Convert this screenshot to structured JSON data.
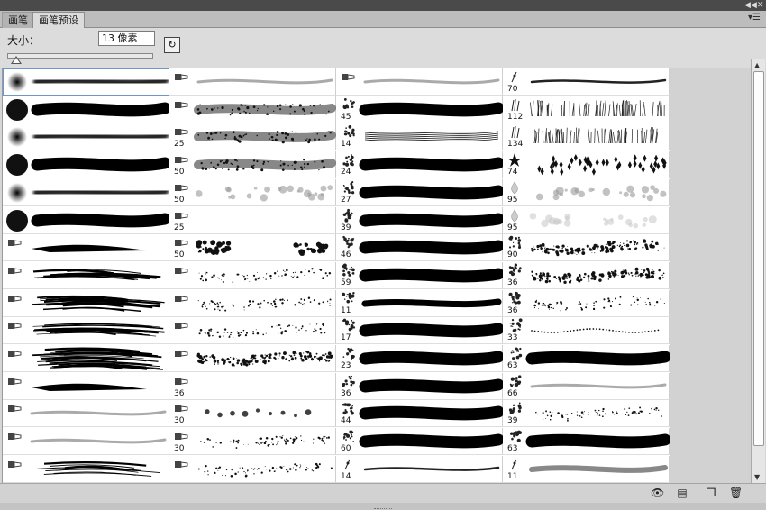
{
  "panel": {
    "tabs": [
      {
        "label": "画笔"
      },
      {
        "label": "画笔预设"
      }
    ],
    "collapse_icon": "double-chevron-icon",
    "menu_icon": "panel-menu-icon"
  },
  "size": {
    "label": "大小：",
    "value": "13 像素",
    "slider_fraction": 0.01
  },
  "brushes": [
    [
      {
        "num": "",
        "tip": "soft-round",
        "stroke": "soft"
      },
      {
        "num": "",
        "tip": "hard-round",
        "stroke": "hard"
      },
      {
        "num": "",
        "tip": "soft-round",
        "stroke": "soft"
      },
      {
        "num": "",
        "tip": "hard-round",
        "stroke": "hard"
      },
      {
        "num": "",
        "tip": "soft-round",
        "stroke": "soft"
      },
      {
        "num": "",
        "tip": "hard-round",
        "stroke": "hard"
      },
      {
        "num": "",
        "tip": "bristle",
        "stroke": "taper"
      },
      {
        "num": "",
        "tip": "bristle",
        "stroke": "streaks"
      },
      {
        "num": "",
        "tip": "bristle",
        "stroke": "dense-streaks"
      },
      {
        "num": "",
        "tip": "bristle",
        "stroke": "dense-streaks"
      },
      {
        "num": "",
        "tip": "bristle",
        "stroke": "wide-streaks"
      },
      {
        "num": "",
        "tip": "bristle",
        "stroke": "taper"
      },
      {
        "num": "",
        "tip": "bristle",
        "stroke": "faint"
      },
      {
        "num": "",
        "tip": "bristle",
        "stroke": "faint"
      },
      {
        "num": "",
        "tip": "bristle",
        "stroke": "streaks"
      }
    ],
    [
      {
        "num": "",
        "tip": "bristle",
        "stroke": "faint"
      },
      {
        "num": "",
        "tip": "bristle",
        "stroke": "textured"
      },
      {
        "num": "25",
        "tip": "bristle",
        "stroke": "textured"
      },
      {
        "num": "50",
        "tip": "bristle",
        "stroke": "textured"
      },
      {
        "num": "50",
        "tip": "bristle",
        "stroke": "speckle"
      },
      {
        "num": "25",
        "tip": "bristle",
        "stroke": "none"
      },
      {
        "num": "50",
        "tip": "bristle",
        "stroke": "blobs"
      },
      {
        "num": "",
        "tip": "bristle",
        "stroke": "spatter"
      },
      {
        "num": "",
        "tip": "bristle",
        "stroke": "spatter"
      },
      {
        "num": "",
        "tip": "bristle",
        "stroke": "spatter"
      },
      {
        "num": "",
        "tip": "bristle",
        "stroke": "dense-spatter"
      },
      {
        "num": "36",
        "tip": "bristle",
        "stroke": "none"
      },
      {
        "num": "30",
        "tip": "bristle",
        "stroke": "dots"
      },
      {
        "num": "30",
        "tip": "bristle",
        "stroke": "spatter"
      },
      {
        "num": "",
        "tip": "bristle",
        "stroke": "spatter"
      }
    ],
    [
      {
        "num": "",
        "tip": "bristle",
        "stroke": "faint"
      },
      {
        "num": "45",
        "tip": "splat",
        "stroke": "hard"
      },
      {
        "num": "14",
        "tip": "splat",
        "stroke": "lines"
      },
      {
        "num": "24",
        "tip": "splat",
        "stroke": "hard"
      },
      {
        "num": "27",
        "tip": "splat",
        "stroke": "hard"
      },
      {
        "num": "39",
        "tip": "splat",
        "stroke": "hard"
      },
      {
        "num": "46",
        "tip": "splat",
        "stroke": "hard"
      },
      {
        "num": "59",
        "tip": "splat",
        "stroke": "hard"
      },
      {
        "num": "11",
        "tip": "splat",
        "stroke": "hard-thin"
      },
      {
        "num": "17",
        "tip": "splat",
        "stroke": "hard"
      },
      {
        "num": "23",
        "tip": "splat",
        "stroke": "hard"
      },
      {
        "num": "36",
        "tip": "splat",
        "stroke": "hard"
      },
      {
        "num": "44",
        "tip": "splat",
        "stroke": "hard"
      },
      {
        "num": "60",
        "tip": "splat",
        "stroke": "hard"
      },
      {
        "num": "14",
        "tip": "dot",
        "stroke": "thin"
      }
    ],
    [
      {
        "num": "70",
        "tip": "dot",
        "stroke": "thin"
      },
      {
        "num": "112",
        "tip": "grass",
        "stroke": "grass"
      },
      {
        "num": "134",
        "tip": "grass",
        "stroke": "grass"
      },
      {
        "num": "74",
        "tip": "leaf",
        "stroke": "leaves"
      },
      {
        "num": "95",
        "tip": "drop",
        "stroke": "soft-blobs"
      },
      {
        "num": "95",
        "tip": "drop",
        "stroke": "pale-blobs"
      },
      {
        "num": "90",
        "tip": "splat",
        "stroke": "chalk"
      },
      {
        "num": "36",
        "tip": "splat",
        "stroke": "dense-spatter"
      },
      {
        "num": "36",
        "tip": "splat",
        "stroke": "spatter"
      },
      {
        "num": "33",
        "tip": "splat",
        "stroke": "dots-line"
      },
      {
        "num": "63",
        "tip": "splat",
        "stroke": "hard"
      },
      {
        "num": "66",
        "tip": "splat",
        "stroke": "faint"
      },
      {
        "num": "39",
        "tip": "splat",
        "stroke": "spatter"
      },
      {
        "num": "63",
        "tip": "splat",
        "stroke": "hard"
      },
      {
        "num": "11",
        "tip": "dot",
        "stroke": "gray"
      }
    ]
  ],
  "footer": {
    "icons": [
      "eye-brush-icon",
      "brush-panel-icon",
      "new-preset-icon",
      "trash-icon"
    ]
  }
}
